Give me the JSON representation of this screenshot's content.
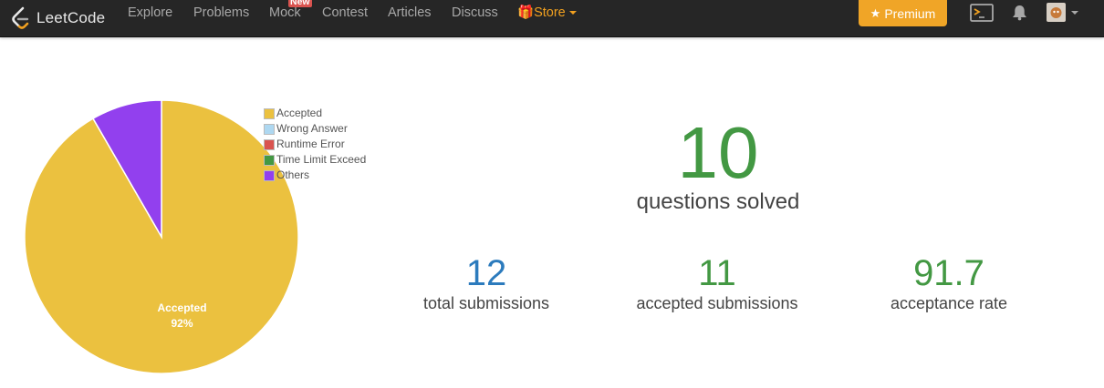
{
  "navbar": {
    "logo_text": "LeetCode",
    "links": {
      "explore": "Explore",
      "problems": "Problems",
      "mock": "Mock",
      "mock_badge": "New",
      "contest": "Contest",
      "articles": "Articles",
      "discuss": "Discuss",
      "store": "Store"
    },
    "premium_label": "Premium"
  },
  "chart_data": {
    "type": "pie",
    "title": "",
    "slices": [
      {
        "label": "Accepted",
        "value": 11,
        "color": "#ebc13f"
      },
      {
        "label": "Wrong Answer",
        "value": 0,
        "color": "#aed8f1"
      },
      {
        "label": "Runtime Error",
        "value": 0,
        "color": "#d9534f"
      },
      {
        "label": "Time Limit Exceed",
        "value": 0,
        "color": "#439843"
      },
      {
        "label": "Others",
        "value": 1,
        "color": "#9240ee"
      }
    ],
    "slice_labels": [
      {
        "name": "Accepted",
        "percent": "92%"
      }
    ],
    "legend_position": "top-right"
  },
  "stats": {
    "solved": {
      "value": "10",
      "label": "questions solved"
    },
    "total": {
      "value": "12",
      "label": "total submissions"
    },
    "accepted": {
      "value": "11",
      "label": "accepted submissions"
    },
    "rate": {
      "value": "91.7",
      "label": "acceptance rate"
    }
  },
  "colors": {
    "accent_green": "#439843",
    "accent_blue": "#2c7bbd",
    "premium": "#f0a527"
  }
}
